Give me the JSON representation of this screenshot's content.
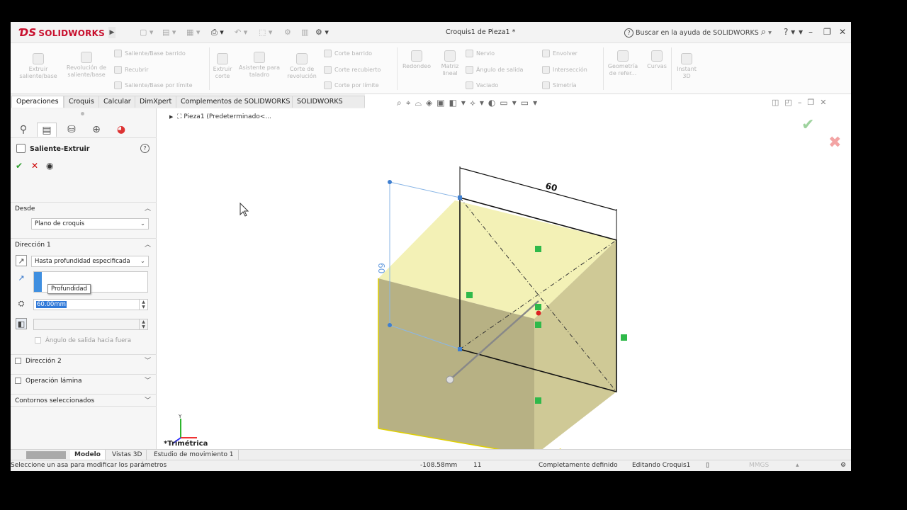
{
  "app": {
    "brand": "SOLIDWORKS",
    "doc_title": "Croquis1 de Pieza1 *",
    "search_placeholder": "Buscar en la ayuda de SOLIDWORKS",
    "help_glyph": "?"
  },
  "command_manager": {
    "extrude_boss": "Extruir saliente/base",
    "revolve_boss": "Revolución de saliente/base",
    "swept_boss": "Saliente/Base barrido",
    "loft_boss": "Recubrir",
    "boundary_boss": "Saliente/Base por límite",
    "extrude_cut": "Extruir corte",
    "hole_wizard": "Asistente para taladro",
    "revolve_cut": "Corte de revolución",
    "swept_cut": "Corte barrido",
    "loft_cut": "Corte recubierto",
    "boundary_cut": "Corte por límite",
    "fillet": "Redondeo",
    "linear_pattern": "Matriz lineal",
    "rib": "Nervio",
    "draft": "Ángulo de salida",
    "shell": "Vaciado",
    "wrap": "Envolver",
    "intersect": "Intersección",
    "mirror": "Simetría",
    "ref_geometry": "Geometría de refer...",
    "curves": "Curvas",
    "instant3d": "Instant 3D"
  },
  "tabs": [
    "Operaciones",
    "Croquis",
    "Calcular",
    "DimXpert",
    "Complementos de SOLIDWORKS",
    "SOLIDWORKS MBD"
  ],
  "property_manager": {
    "title": "Saliente-Extruir",
    "from_label": "Desde",
    "from_value": "Plano de croquis",
    "direction1_label": "Dirección 1",
    "end_condition": "Hasta profundidad especificada",
    "tooltip": "Profundidad",
    "depth_value": "60.00mm",
    "draft_outward": "Ángulo de salida hacia fuera",
    "direction2_label": "Dirección 2",
    "thin_feature_label": "Operación lámina",
    "selected_contours_label": "Contornos seleccionados"
  },
  "feature_tree": {
    "root": "Pieza1  (Predeterminado<..."
  },
  "viewport": {
    "dimension_top": "60",
    "dimension_side": "60",
    "view_name": "*Trimétrica",
    "axis_y": "Y",
    "cube_face_color": "#f3f1b6",
    "cube_front_color": "#b7b184",
    "cube_side_color": "#cfc996"
  },
  "bottom_tabs": [
    "Modelo",
    "Vistas 3D",
    "Estudio de movimiento 1"
  ],
  "status_bar": {
    "message": "Seleccione un asa para modificar los parámetros",
    "coord": "-108.58mm",
    "coord2": "11",
    "sketch_state": "Completamente definido",
    "editing": "Editando Croquis1",
    "units": "MMGS"
  }
}
